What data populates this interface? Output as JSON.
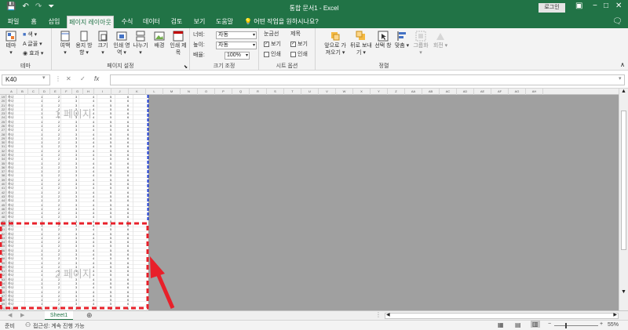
{
  "titlebar": {
    "title": "통합 문서1 - Excel",
    "login_label": "로그인",
    "ribbon_display_icon": "ribbon-display-icon",
    "minimize_icon": "minimize-icon",
    "maximize_icon": "maximize-icon",
    "close_icon": "close-icon"
  },
  "menu": {
    "tabs": [
      {
        "label": "파일",
        "active": false
      },
      {
        "label": "홈",
        "active": false
      },
      {
        "label": "삽입",
        "active": false
      },
      {
        "label": "페이지 레이아웃",
        "active": true
      },
      {
        "label": "수식",
        "active": false
      },
      {
        "label": "데이터",
        "active": false
      },
      {
        "label": "검토",
        "active": false
      },
      {
        "label": "보기",
        "active": false
      },
      {
        "label": "도움말",
        "active": false
      }
    ],
    "tell_me": "어떤 작업을 원하시나요?"
  },
  "ribbon": {
    "theme_group": {
      "label": "테마",
      "theme_btn": "테마",
      "colors_btn": "색",
      "fonts_btn": "글꼴",
      "effects_btn": "효과"
    },
    "page_setup_group": {
      "label": "페이지 설정",
      "margins": "여백",
      "orientation": "용지 방향",
      "size": "크기",
      "print_area": "인쇄 영역",
      "breaks": "나누기",
      "background": "배경",
      "print_titles": "인쇄 제목"
    },
    "scale_group": {
      "label": "크기 조정",
      "width_label": "너비:",
      "width_value": "자동",
      "height_label": "높이:",
      "height_value": "자동",
      "scale_label": "배율:",
      "scale_value": "100%"
    },
    "sheet_options_group": {
      "label": "시트 옵션",
      "gridlines": "눈금선",
      "headings": "제목",
      "view": "보기",
      "print": "인쇄",
      "gridlines_view": true,
      "gridlines_print": false,
      "headings_view": true,
      "headings_print": false
    },
    "arrange_group": {
      "label": "정렬",
      "bring_forward": "앞으로 가져오기",
      "send_backward": "뒤로 보내기",
      "selection_pane": "선택 창",
      "align": "맞춤",
      "group": "그룹화",
      "rotate": "회전"
    }
  },
  "formula_bar": {
    "name_box": "K40",
    "formula": "",
    "fx_label": "fx"
  },
  "grid": {
    "col_headers": [
      "A",
      "B",
      "C",
      "D",
      "E",
      "F",
      "G",
      "H",
      "I",
      "J",
      "K",
      "L",
      "M",
      "N",
      "O",
      "P",
      "Q",
      "R",
      "S",
      "T",
      "U",
      "V",
      "W",
      "X",
      "Y",
      "Z",
      "AA",
      "AB",
      "AC",
      "AD",
      "AE",
      "AF",
      "AG",
      "AH"
    ],
    "page1_label": "1 페이지",
    "page2_label": "2 페이지",
    "row_start": 19,
    "row_count": 52,
    "row_label": "하나",
    "row_values": [
      "1",
      "2",
      "3",
      "4",
      "5",
      "6"
    ]
  },
  "sheet_tabs": {
    "active": "Sheet1",
    "add_icon": "add-sheet-icon"
  },
  "status": {
    "ready": "준비",
    "accessibility": "접근성: 계속 진행 가능",
    "zoom": "55%"
  },
  "colors": {
    "excel_green": "#217346",
    "page_break_blue": "#1f3fd6",
    "annotation_red": "#e8202a"
  }
}
